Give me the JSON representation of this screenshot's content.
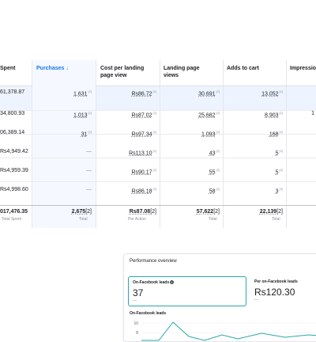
{
  "table": {
    "headers": {
      "spent": "Spent",
      "purchases": "Purchases ↓",
      "cost": "Cost per landing page view",
      "landing": "Landing page views",
      "adds": "Adds to cart",
      "impressions": "Impressio"
    },
    "rows": [
      {
        "spent": "61,378.87",
        "purchases": "1,631",
        "cost": "Rs86.72",
        "landing": "30,691",
        "adds": "13,052",
        "impressions": ""
      },
      {
        "spent": "34,800.93",
        "purchases": "1,013",
        "cost": "Rs87.02",
        "landing": "25,682",
        "adds": "8,903",
        "impressions": "1"
      },
      {
        "spent": "06,389.14",
        "purchases": "31",
        "cost": "Rs97.34",
        "landing": "1,093",
        "adds": "168",
        "impressions": ""
      },
      {
        "spent": "Rs4,949.42",
        "purchases": "—",
        "cost": "Rs113.10",
        "landing": "43",
        "adds": "5",
        "impressions": ""
      },
      {
        "spent": "Rs4,959.39",
        "purchases": "—",
        "cost": "Rs90.17",
        "landing": "55",
        "adds": "5",
        "impressions": ""
      },
      {
        "spent": "Rs4,998.60",
        "purchases": "—",
        "cost": "Rs86.18",
        "landing": "58",
        "adds": "3",
        "impressions": ""
      }
    ],
    "totals": {
      "spent": "017,476.35",
      "spent_sub": "Total Spent",
      "purchases": "2,675",
      "purchases_sub": "Total",
      "cost": "Rs87.08",
      "cost_sub": "Per Action",
      "landing": "57,622",
      "landing_sub": "Total",
      "adds": "22,139",
      "adds_sub": "Total"
    }
  },
  "performance": {
    "title": "Performance overview",
    "metric1_label": "On-Facebook leads",
    "metric1_value": "37",
    "metric1_sub": "—",
    "metric2_label": "Per on-Facebook leads",
    "metric2_value": "Rs120.30",
    "metric2_sub": "—",
    "chart_title": "On-Facebook leads",
    "y_ticks": [
      "10",
      "8"
    ],
    "accent": "#2aa8a8"
  }
}
